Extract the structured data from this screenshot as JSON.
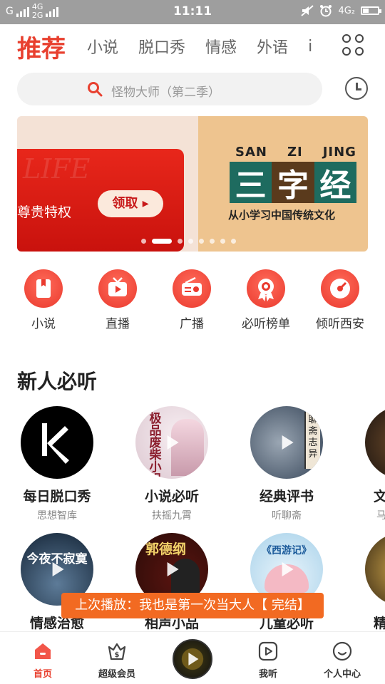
{
  "status_bar": {
    "carrier_left": "G",
    "net1_top": "4G",
    "net1_bottom": "2G",
    "time": "11:11",
    "net2": "4G₂"
  },
  "tabs": [
    {
      "label": "推荐",
      "active": true
    },
    {
      "label": "小说"
    },
    {
      "label": "脱口秀"
    },
    {
      "label": "情感"
    },
    {
      "label": "外语"
    },
    {
      "label": "i"
    }
  ],
  "search": {
    "placeholder": "怪物大师（第二季）"
  },
  "banner": {
    "left_bg_text": "LIFE",
    "left_text": "尊贵特权",
    "claim_button": "领取 ▸",
    "right_pinyin": [
      "SAN",
      "ZI",
      "JING"
    ],
    "right_title_chars": [
      "三",
      "字",
      "经"
    ],
    "right_subtitle": "从小学习中国传统文化",
    "active_dot_index": 1,
    "dot_count": 8
  },
  "categories": [
    {
      "label": "小说",
      "icon": "book-icon"
    },
    {
      "label": "直播",
      "icon": "tv-icon"
    },
    {
      "label": "广播",
      "icon": "radio-icon"
    },
    {
      "label": "必听榜单",
      "icon": "award-icon"
    },
    {
      "label": "倾听西安",
      "icon": "disc-icon"
    }
  ],
  "section": {
    "title": "新人必听"
  },
  "albums_row1": [
    {
      "name": "每日脱口秀",
      "sub": "思想智库",
      "cover_text": "K"
    },
    {
      "name": "小说必听",
      "sub": "扶摇九霄",
      "cover_text": "极品废柴小姐"
    },
    {
      "name": "经典评书",
      "sub": "听聊斋",
      "cover_text": "聊斋志异"
    },
    {
      "name": "文",
      "sub": "马",
      "cover_text": ""
    }
  ],
  "albums_row2": [
    {
      "name": "情感治愈",
      "sub": "",
      "cover_text": "今夜不寂寞"
    },
    {
      "name": "相声小品",
      "sub": "",
      "cover_text": "郭德纲"
    },
    {
      "name": "儿童必听",
      "sub": "",
      "cover_text": "《西游记》"
    },
    {
      "name": "精",
      "sub": "",
      "cover_text": ""
    }
  ],
  "toast": {
    "text": "上次播放：我也是第一次当大人【 完结】"
  },
  "bottom_nav": [
    {
      "label": "首页",
      "icon": "home-icon",
      "active": true
    },
    {
      "label": "超级会员",
      "icon": "vip-bag-icon"
    },
    {
      "label": "",
      "icon": "now-playing-disc-icon"
    },
    {
      "label": "我听",
      "icon": "play-square-icon"
    },
    {
      "label": "个人中心",
      "icon": "profile-face-icon"
    }
  ],
  "colors": {
    "accent": "#e8402f",
    "toast": "#f26a22",
    "status_bar": "#9e9e9e"
  }
}
